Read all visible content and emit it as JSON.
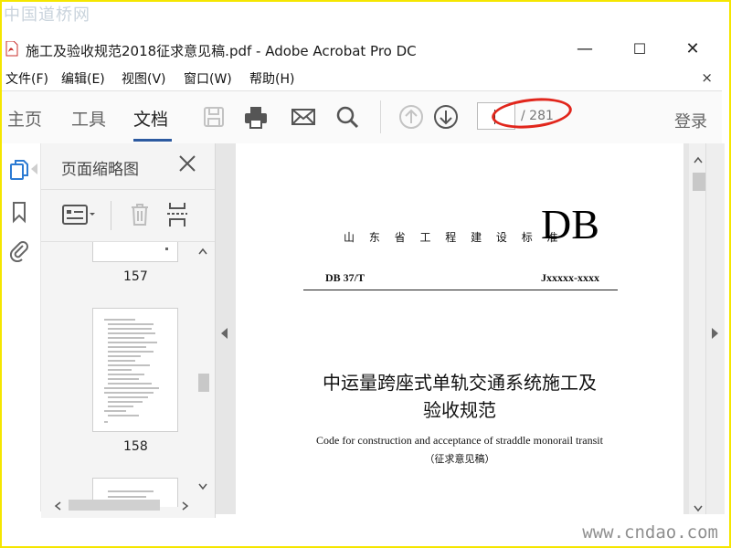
{
  "watermarks": {
    "top": "中国道桥网",
    "bottom": "www.cndao.com"
  },
  "window": {
    "title": "施工及验收规范2018征求意见稿.pdf - Adobe Acrobat Pro DC",
    "minimize": "—",
    "maximize": "☐",
    "close": "✕"
  },
  "menu": {
    "items": [
      "文件(F)",
      "编辑(E)",
      "视图(V)",
      "窗口(W)",
      "帮助(H)"
    ],
    "close_doc": "×"
  },
  "toolbar": {
    "tabs": [
      "主页",
      "工具",
      "文档"
    ],
    "active_tab": "文档",
    "page_current": "",
    "page_total": "/ 281",
    "login": "登录",
    "icons": [
      "save-icon",
      "print-icon",
      "mail-icon",
      "search-icon",
      "page-up-icon",
      "page-down-icon"
    ]
  },
  "left_rail": {
    "icons": [
      "page-thumbnails-icon",
      "bookmark-icon",
      "attachment-icon"
    ]
  },
  "thumbnail_panel": {
    "title": "页面缩略图",
    "pages": [
      {
        "label": "157"
      },
      {
        "label": "158"
      }
    ]
  },
  "document": {
    "standard_header": "山 东 省 工 程 建 设 标 准",
    "db": "DB",
    "code": "DB 37/T",
    "number": "Jxxxxx-xxxx",
    "title_line1": "中运量跨座式单轨交通系统施工及",
    "title_line2": "验收规范",
    "english_title": "Code for construction and acceptance of straddle monorail transit",
    "draft": "（征求意见稿）"
  },
  "colors": {
    "accent": "#2c5aa0",
    "annotation": "#e1261c",
    "frame": "#f5e600"
  }
}
